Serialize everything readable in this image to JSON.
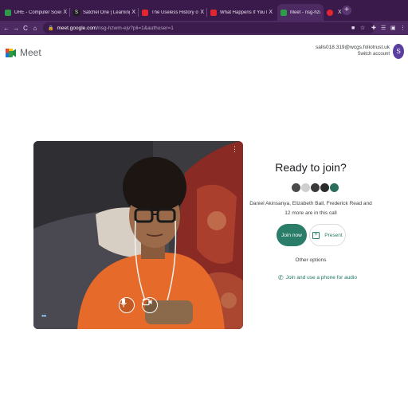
{
  "browser": {
    "tabs": [
      {
        "title": "URE - Computer Science",
        "close": "X",
        "favicon_color": "#2e9b4a"
      },
      {
        "title": "Satchel One | Learning platfor",
        "close": "X",
        "favicon_color": "#1d1d1d"
      },
      {
        "title": "The Useless History of Chairs",
        "close": "X",
        "favicon_color": "#e0272f"
      },
      {
        "title": "What Happens If You Pretend",
        "close": "X",
        "favicon_color": "#e0272f"
      },
      {
        "title": "Meet - nsg-hzwm-ejv",
        "close": "",
        "favicon_color": "#2e9b4a"
      },
      {
        "title": "",
        "close": "X",
        "favicon_color": "#e0272f"
      }
    ],
    "new_tab": "+",
    "nav": {
      "back": "←",
      "forward": "→",
      "reload": "C",
      "home": "⌂"
    },
    "url_host": "meet.google.com",
    "url_path": "/nsg-hzwm-ejv?pli=1&authuser=1",
    "lock": "🔒"
  },
  "meet": {
    "brand": "Meet",
    "account_email": "salls018.319@wcgs.foliotrust.uk",
    "switch_account": "Switch account",
    "avatar_letter": "S"
  },
  "preview": {
    "more": "⋮",
    "signal": "•••"
  },
  "join_panel": {
    "title": "Ready to join?",
    "participant_colors": [
      "#4a4a4a",
      "#cfcfcf",
      "#3a3a3a",
      "#2b2b2b",
      "#2b6e5c"
    ],
    "participants_text": "Daniel Akinsanya, Elizabeth Ball, Frederick Read and 12 more are in this call",
    "join_label": "Join now",
    "present_label": "Present",
    "other_options": "Other options",
    "phone_label": "Join and use a phone for audio"
  },
  "colors": {
    "accent": "#2a7d68",
    "chrome": "#4e2a63"
  }
}
